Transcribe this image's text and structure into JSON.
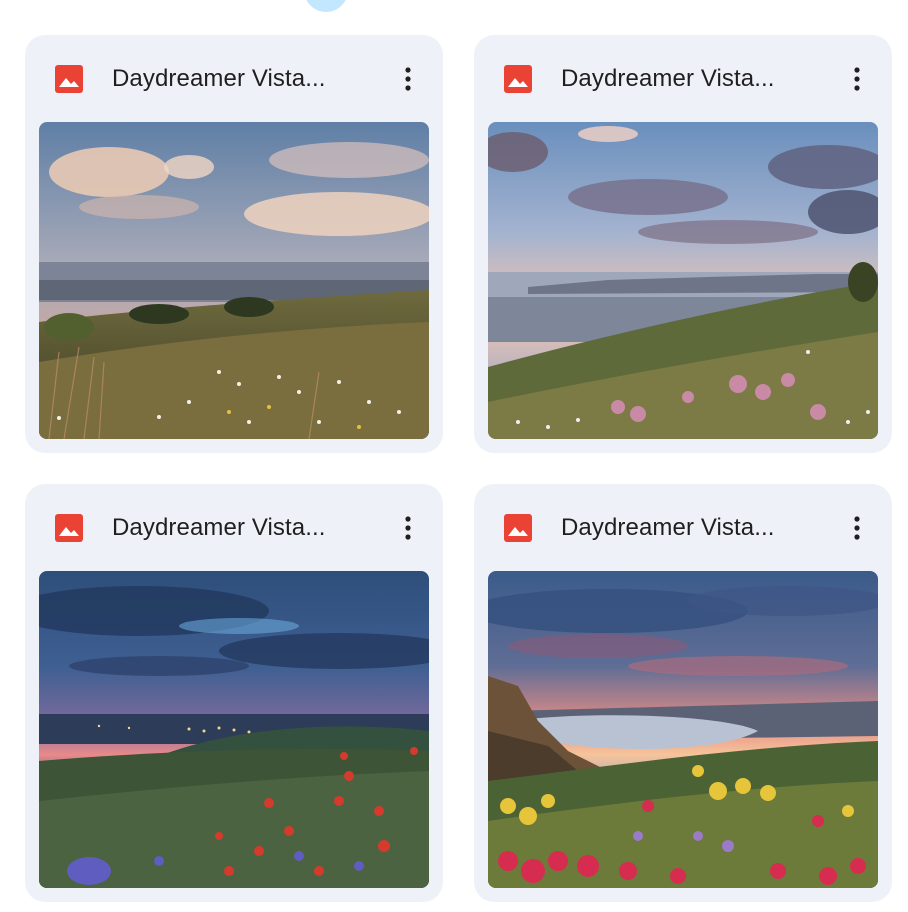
{
  "cards": [
    {
      "title": "Daydreamer Vista...",
      "icon": "image-file-icon",
      "menu_icon": "more-vert-icon"
    },
    {
      "title": "Daydreamer Vista...",
      "icon": "image-file-icon",
      "menu_icon": "more-vert-icon"
    },
    {
      "title": "Daydreamer Vista...",
      "icon": "image-file-icon",
      "menu_icon": "more-vert-icon"
    },
    {
      "title": "Daydreamer Vista...",
      "icon": "image-file-icon",
      "menu_icon": "more-vert-icon"
    }
  ],
  "colors": {
    "card_bg": "#eef1f7",
    "icon_red": "#ea4335",
    "text": "#1f1f1f",
    "selected_chip": "#c2e7ff"
  }
}
